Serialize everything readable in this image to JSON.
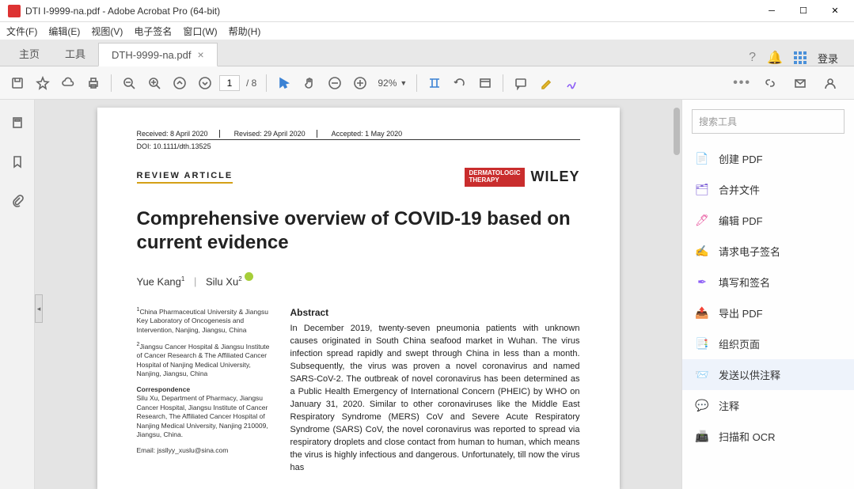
{
  "window": {
    "title": "DTI I-9999-na.pdf - Adobe Acrobat Pro (64-bit)"
  },
  "menu": {
    "file": "文件(F)",
    "edit": "编辑(E)",
    "view": "视图(V)",
    "esign": "电子签名",
    "window": "窗口(W)",
    "help": "帮助(H)"
  },
  "tabs": {
    "home": "主页",
    "tools": "工具",
    "doc": "DTH-9999-na.pdf"
  },
  "login": "登录",
  "toolbar": {
    "page_current": "1",
    "page_total": "/ 8",
    "zoom": "92%"
  },
  "rightpanel": {
    "search_placeholder": "搜索工具",
    "items": {
      "create": "创建 PDF",
      "combine": "合并文件",
      "edit": "编辑 PDF",
      "reqsign": "请求电子签名",
      "fillsign": "填写和签名",
      "export": "导出 PDF",
      "organize": "组织页面",
      "sendcomment": "发送以供注释",
      "comment": "注释",
      "scan": "扫描和 OCR"
    }
  },
  "doc": {
    "received": "Received: 8 April 2020",
    "revised": "Revised: 29 April 2020",
    "accepted": "Accepted: 1 May 2020",
    "doi": "DOI: 10.1111/dth.13525",
    "review_article": "REVIEW ARTICLE",
    "derm": "DERMATOLOGIC THERAPY",
    "wiley": "WILEY",
    "title": "Comprehensive overview of COVID-19 based on current evidence",
    "author1": "Yue Kang",
    "sup1": "1",
    "author2": "Silu Xu",
    "sup2": "2",
    "affil1": "China Pharmaceutical University & Jiangsu Key Laboratory of Oncogenesis and Intervention, Nanjing, Jiangsu, China",
    "affil2": "Jiangsu Cancer Hospital & Jiangsu Institute of Cancer Research & The Affiliated Cancer Hospital of Nanjing Medical University, Nanjing, Jiangsu, China",
    "corr_head": "Correspondence",
    "corr": "Silu Xu, Department of Pharmacy, Jiangsu Cancer Hospital, Jiangsu Institute of Cancer Research, The Affiliated Cancer Hospital of Nanjing Medical University, Nanjing 210009, Jiangsu, China.",
    "email": "Email: jssllyy_xuslu@sina.com",
    "abstract_head": "Abstract",
    "abstract": "In December 2019, twenty-seven pneumonia patients with unknown causes originated in South China seafood market in Wuhan. The virus infection spread rapidly and swept through China in less than a month. Subsequently, the virus was proven a novel coronavirus and named SARS-CoV-2. The outbreak of novel coronavirus has been determined as a Public Health Emergency of International Concern (PHEIC) by WHO on January 31, 2020. Similar to other coronaviruses like the Middle East Respiratory Syndrome (MERS) CoV and Severe Acute Respiratory Syndrome (SARS) CoV, the novel coronavirus was reported to spread via respiratory droplets and close contact from human to human, which means the virus is highly infectious and dangerous. Unfortunately, till now the virus has"
  }
}
